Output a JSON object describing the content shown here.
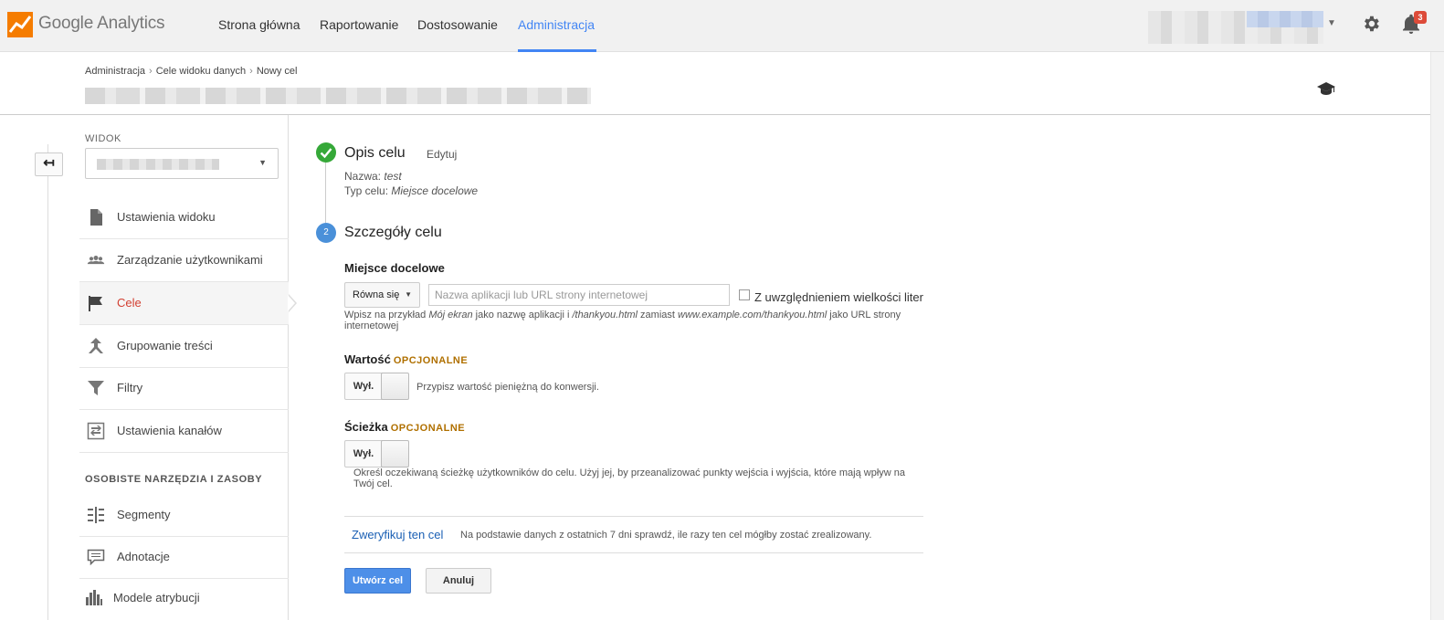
{
  "app": {
    "logo_text": "Google Analytics"
  },
  "topnav": {
    "items": [
      {
        "label": "Strona główna"
      },
      {
        "label": "Raportowanie"
      },
      {
        "label": "Dostosowanie"
      },
      {
        "label": "Administracja",
        "active": true
      }
    ],
    "notifications_count": "3",
    "accent_color": "#4285f4"
  },
  "breadcrumb": [
    "Administracja",
    "Cele widoku danych",
    "Nowy cel"
  ],
  "sidebar": {
    "back_label": "↤",
    "view_label": "WIDOK",
    "items": [
      {
        "label": "Ustawienia widoku",
        "icon": "document-icon"
      },
      {
        "label": "Zarządzanie użytkownikami",
        "icon": "users-icon"
      },
      {
        "label": "Cele",
        "icon": "flag-icon",
        "active": true
      },
      {
        "label": "Grupowanie treści",
        "icon": "grouping-icon"
      },
      {
        "label": "Filtry",
        "icon": "filter-icon"
      },
      {
        "label": "Ustawienia kanałów",
        "icon": "channels-icon"
      }
    ],
    "section_header": "OSOBISTE NARZĘDZIA I ZASOBY",
    "tools": [
      {
        "label": "Segmenty",
        "icon": "segments-icon"
      },
      {
        "label": "Adnotacje",
        "icon": "annotations-icon"
      },
      {
        "label": "Modele atrybucji",
        "icon": "attribution-icon"
      }
    ]
  },
  "goal": {
    "step1": {
      "title": "Opis celu",
      "edit": "Edytuj",
      "name_label": "Nazwa:",
      "name_value": "test",
      "type_label": "Typ celu:",
      "type_value": "Miejsce docelowe"
    },
    "step2": {
      "number": "2",
      "title": "Szczegóły celu",
      "destination_label": "Miejsce docelowe",
      "match_type": "Równa się",
      "url_placeholder": "Nazwa aplikacji lub URL strony internetowej",
      "case_sensitive_label": "Z uwzględnieniem wielkości liter",
      "hint": {
        "p1": "Wpisz na przykład ",
        "i1": "Mój ekran",
        "p2": " jako nazwę aplikacji i ",
        "i2": "/thankyou.html",
        "p3": " zamiast ",
        "i3": "www.example.com/thankyou.html",
        "p4": " jako URL strony internetowej"
      },
      "value_label": "Wartość",
      "optional": "OPCJONALNE",
      "toggle_off": "Wył.",
      "value_desc": "Przypisz wartość pieniężną do konwersji.",
      "funnel_label": "Ścieżka",
      "funnel_desc": "Określ oczekiwaną ścieżkę użytkowników do celu. Użyj jej, by przeanalizować punkty wejścia i wyjścia, które mają wpływ na Twój cel.",
      "verify_link": "Zweryfikuj ten cel",
      "verify_desc": "Na podstawie danych z ostatnich 7 dni sprawdź, ile razy ten cel mógłby zostać zrealizowany."
    },
    "buttons": {
      "create": "Utwórz cel",
      "cancel": "Anuluj"
    }
  },
  "colors": {
    "active_item": "#d23f31",
    "step_done": "#35a838",
    "step_current": "#4a90d9",
    "optional": "#b07000",
    "link": "#1a5fb4"
  }
}
